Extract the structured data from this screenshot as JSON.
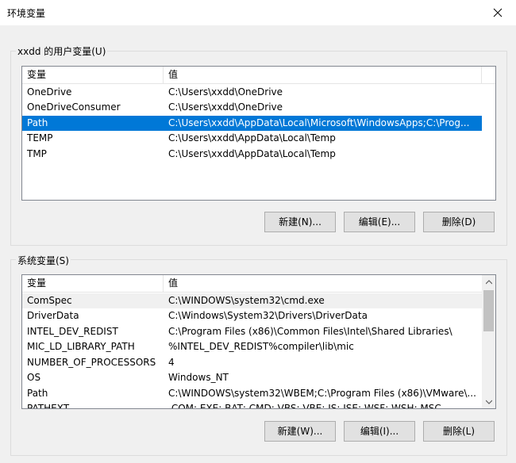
{
  "window": {
    "title": "环境变量"
  },
  "user_vars": {
    "group_label": "xxdd 的用户变量(U)",
    "col_name": "变量",
    "col_value": "值",
    "rows": [
      {
        "name": "OneDrive",
        "value": "C:\\Users\\xxdd\\OneDrive"
      },
      {
        "name": "OneDriveConsumer",
        "value": "C:\\Users\\xxdd\\OneDrive"
      },
      {
        "name": "Path",
        "value": "C:\\Users\\xxdd\\AppData\\Local\\Microsoft\\WindowsApps;C:\\Prog..."
      },
      {
        "name": "TEMP",
        "value": "C:\\Users\\xxdd\\AppData\\Local\\Temp"
      },
      {
        "name": "TMP",
        "value": "C:\\Users\\xxdd\\AppData\\Local\\Temp"
      }
    ],
    "buttons": {
      "new": "新建(N)...",
      "edit": "编辑(E)...",
      "delete": "删除(D)"
    }
  },
  "system_vars": {
    "group_label": "系统变量(S)",
    "col_name": "变量",
    "col_value": "值",
    "rows": [
      {
        "name": "ComSpec",
        "value": "C:\\WINDOWS\\system32\\cmd.exe"
      },
      {
        "name": "DriverData",
        "value": "C:\\Windows\\System32\\Drivers\\DriverData"
      },
      {
        "name": "INTEL_DEV_REDIST",
        "value": "C:\\Program Files (x86)\\Common Files\\Intel\\Shared Libraries\\"
      },
      {
        "name": "MIC_LD_LIBRARY_PATH",
        "value": "%INTEL_DEV_REDIST%compiler\\lib\\mic"
      },
      {
        "name": "NUMBER_OF_PROCESSORS",
        "value": "4"
      },
      {
        "name": "OS",
        "value": "Windows_NT"
      },
      {
        "name": "Path",
        "value": "C:\\WINDOWS\\system32\\WBEM;C:\\Program Files (x86)\\VMware\\..."
      },
      {
        "name": "PATHEXT",
        "value": ".COM;.EXE;.BAT;.CMD;.VBS;.VBE;.JS;.JSE;.WSF;.WSH;.MSC"
      }
    ],
    "buttons": {
      "new": "新建(W)...",
      "edit": "编辑(I)...",
      "delete": "删除(L)"
    }
  }
}
